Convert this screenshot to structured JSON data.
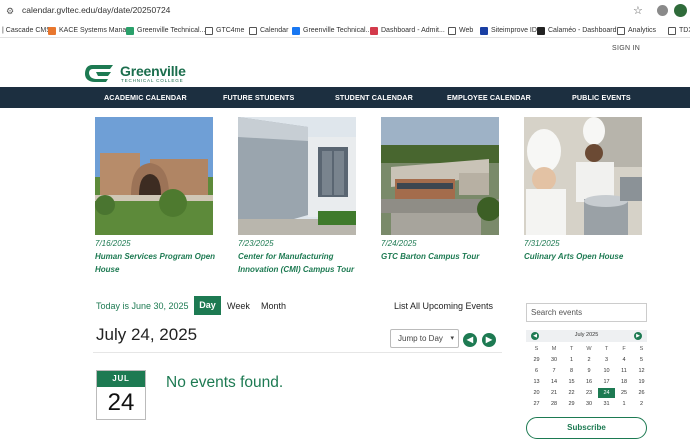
{
  "browser": {
    "url": "calendar.gvltec.edu/day/date/20250724",
    "bookmarks": [
      {
        "label": "| Cascade CMS",
        "icon": "none-icon",
        "color": "#ffffff"
      },
      {
        "label": "KACE Systems Mana...",
        "icon": "kace-icon",
        "color": "#e8772e"
      },
      {
        "label": "Greenville Technical...",
        "icon": "gtc-icon",
        "color": "#2aa06a"
      },
      {
        "label": "GTC4me",
        "icon": "folder-icon",
        "color": "#555555"
      },
      {
        "label": "Calendar",
        "icon": "folder-icon",
        "color": "#555555"
      },
      {
        "label": "Greenville Technical...",
        "icon": "facebook-icon",
        "color": "#1877f2"
      },
      {
        "label": "Dashboard - Admit...",
        "icon": "dashboard-icon",
        "color": "#d33a4b"
      },
      {
        "label": "Web",
        "icon": "folder-icon",
        "color": "#555555"
      },
      {
        "label": "Siteimprove ID",
        "icon": "siteimprove-icon",
        "color": "#1a3fa3"
      },
      {
        "label": "Calaméo - Dashboard",
        "icon": "calameo-icon",
        "color": "#222222"
      },
      {
        "label": "Analytics",
        "icon": "folder-icon",
        "color": "#555555"
      },
      {
        "label": "TDX",
        "icon": "folder-icon",
        "color": "#555555"
      }
    ]
  },
  "header": {
    "signin": "SIGN IN",
    "logo_name": "Greenville",
    "logo_sub": "TECHNICAL COLLEGE"
  },
  "nav": [
    "ACADEMIC CALENDAR",
    "FUTURE STUDENTS",
    "STUDENT CALENDAR",
    "EMPLOYEE CALENDAR",
    "PUBLIC EVENTS"
  ],
  "featured": [
    {
      "date": "7/16/2025",
      "title": "Human Services Program Open House"
    },
    {
      "date": "7/23/2025",
      "title": "Center for Manufacturing Innovation (CMI) Campus Tour"
    },
    {
      "date": "7/24/2025",
      "title": "GTC Barton Campus Tour"
    },
    {
      "date": "7/31/2025",
      "title": "Culinary Arts Open House"
    }
  ],
  "controls": {
    "today": "Today is June 30, 2025",
    "day": "Day",
    "week": "Week",
    "month": "Month",
    "list_all": "List All Upcoming Events",
    "current_date": "July 24, 2025",
    "jump_to": "Jump to Day"
  },
  "day_box": {
    "month": "JUL",
    "day": "24"
  },
  "no_events": "No events found.",
  "sidebar": {
    "search_placeholder": "Search events",
    "minical": {
      "title": "July 2025",
      "dow": [
        "S",
        "M",
        "T",
        "W",
        "T",
        "F",
        "S"
      ],
      "weeks": [
        [
          "29",
          "30",
          "1",
          "2",
          "3",
          "4",
          "5"
        ],
        [
          "6",
          "7",
          "8",
          "9",
          "10",
          "11",
          "12"
        ],
        [
          "13",
          "14",
          "15",
          "16",
          "17",
          "18",
          "19"
        ],
        [
          "20",
          "21",
          "22",
          "23",
          "24",
          "25",
          "26"
        ],
        [
          "27",
          "28",
          "29",
          "30",
          "31",
          "1",
          "2"
        ]
      ],
      "selected": "24"
    },
    "subscribe": "Subscribe"
  },
  "colors": {
    "brand_green": "#1d7a52",
    "nav_bg": "#1c2f40"
  }
}
